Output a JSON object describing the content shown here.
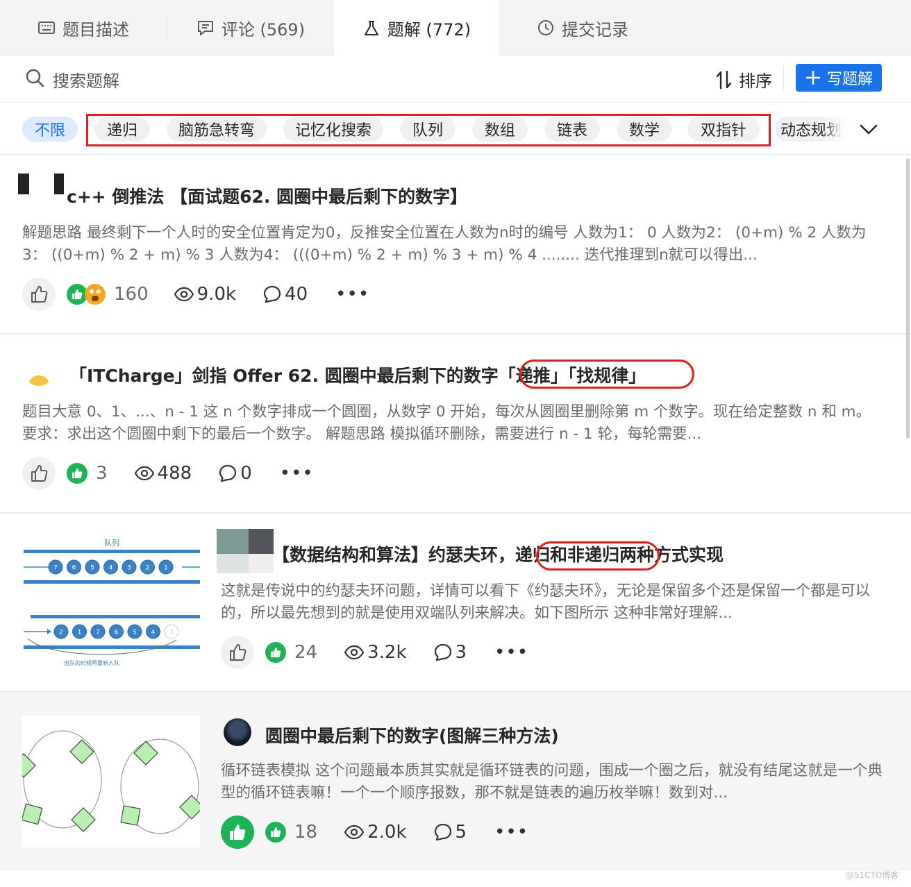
{
  "tabs": [
    {
      "label": "题目描述",
      "icon": "keyboard-icon"
    },
    {
      "label": "评论 (569)",
      "icon": "comment-icon"
    },
    {
      "label": "题解 (772)",
      "icon": "flask-icon"
    },
    {
      "label": "提交记录",
      "icon": "clock-icon"
    }
  ],
  "search": {
    "placeholder": "搜索题解"
  },
  "toolbar": {
    "sort_label": "排序",
    "write_label": "写题解"
  },
  "tags": [
    "不限",
    "递归",
    "脑筋急转弯",
    "记忆化搜索",
    "队列",
    "数组",
    "链表",
    "数学",
    "双指针",
    "动态规划"
  ],
  "posts": [
    {
      "title": "c++ 倒推法 【面试题62. 圆圈中最后剩下的数字】",
      "summary": "解题思路 最终剩下一个人时的安全位置肯定为0，反推安全位置在人数为n时的编号 人数为1： 0 人数为2： (0+m) % 2 人数为3： ((0+m) % 2 + m) % 3 人数为4： (((0+m) % 2 + m) % 3 + m) % 4 ........ 迭代推理到n就可以得出...",
      "reactions": "160",
      "views": "9.0k",
      "comments": "40"
    },
    {
      "title": "「ITCharge」剑指 Offer 62. 圆圈中最后剩下的数字「递推」「找规律」",
      "summary": "题目大意 0、1、...、n - 1 这 n 个数字排成一个圆圈，从数字 0 开始，每次从圆圈里删除第 m 个数字。现在给定整数 n 和 m。 要求：求出这个圆圈中剩下的最后一个数字。 解题思路 模拟循环删除，需要进行 n - 1 轮，每轮需要...",
      "reactions": "3",
      "views": "488",
      "comments": "0"
    },
    {
      "title": "【数据结构和算法】约瑟夫环，递归和非递归两种方式实现",
      "summary": "这就是传说中的约瑟夫环问题，详情可以看下《约瑟夫环》，无论是保留多个还是保留一个都是可以的，所以最先想到的就是使用双端队列来解决。如下图所示 这种非常好理解...",
      "reactions": "24",
      "views": "3.2k",
      "comments": "3",
      "thumb_title": "队列",
      "thumb_caption": "出队的时候再重新入队",
      "queue_row1": [
        "7",
        "6",
        "5",
        "4",
        "3",
        "2",
        "1"
      ],
      "queue_row2": [
        "2",
        "1",
        "7",
        "6",
        "5",
        "4",
        "3"
      ]
    },
    {
      "title": "圆圈中最后剩下的数字(图解三种方法)",
      "summary": "循环链表模拟 这个问题最本质其实就是循环链表的问题，围成一个圈之后，就没有结尾这就是一个典型的循环链表嘛！一个一个顺序报数，那不就是链表的遍历枚举嘛！数到对...",
      "reactions": "18",
      "views": "2.0k",
      "comments": "5"
    }
  ],
  "watermark": "@51CTO博客",
  "colors": {
    "accent": "#1a73e8",
    "like_green": "#1fb357",
    "highlight_red": "#e01e1e"
  }
}
